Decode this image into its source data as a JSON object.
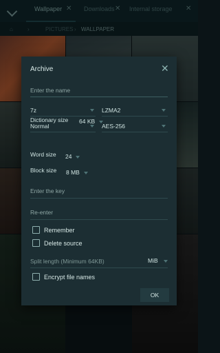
{
  "tabs": [
    {
      "label": "Wallpaper",
      "active": true
    },
    {
      "label": "Downloads",
      "active": false
    },
    {
      "label": "Internal storage",
      "active": false
    }
  ],
  "breadcrumb": [
    "PICTURES",
    "WALLPAPER"
  ],
  "dialog": {
    "title": "Archive",
    "name_placeholder": "Enter the name",
    "format": "7z",
    "method": "LZMA2",
    "level": "Normal",
    "encryption": "AES-256",
    "dictionary_label": "Dictionary size",
    "dictionary_value": "64 KB",
    "word_label": "Word size",
    "word_value": "24",
    "block_label": "Block size",
    "block_value": "8 MB",
    "key_placeholder": "Enter the key",
    "reenter_placeholder": "Re-enter",
    "remember_label": "Remember",
    "delete_source_label": "Delete source",
    "split_placeholder": "Split length (Minimum 64KB)",
    "split_unit": "MiB",
    "encrypt_names_label": "Encrypt file names",
    "ok_label": "OK"
  },
  "colors": {
    "dialog_bg": "#1c2e33",
    "accent": "#4f7376",
    "text": "#cfe3e1"
  }
}
